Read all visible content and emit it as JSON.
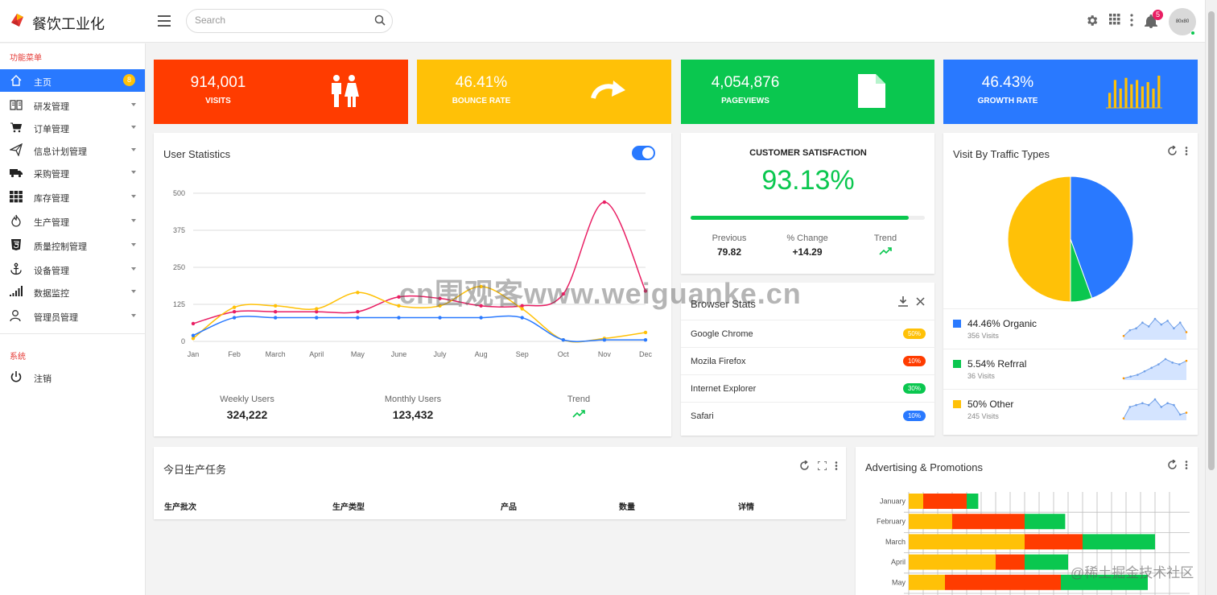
{
  "app": {
    "title": "餐饮工业化"
  },
  "header": {
    "search_placeholder": "Search",
    "notification_count": "5",
    "avatar_text": "80x80"
  },
  "sidebar": {
    "section_main": "功能菜单",
    "items": [
      {
        "label": "主页",
        "icon": "home-icon",
        "badge": "8",
        "active": true
      },
      {
        "label": "研发管理",
        "icon": "book-icon"
      },
      {
        "label": "订单管理",
        "icon": "cart-icon"
      },
      {
        "label": "信息计划管理",
        "icon": "send-icon"
      },
      {
        "label": "采购管理",
        "icon": "truck-icon"
      },
      {
        "label": "库存管理",
        "icon": "grid-icon"
      },
      {
        "label": "生产管理",
        "icon": "fire-icon"
      },
      {
        "label": "质量控制管理",
        "icon": "html5-icon"
      },
      {
        "label": "设备管理",
        "icon": "anchor-icon"
      },
      {
        "label": "数据监控",
        "icon": "signal-icon"
      },
      {
        "label": "管理员管理",
        "icon": "user-icon"
      }
    ],
    "section_system": "系统",
    "logout_label": "注销"
  },
  "stats": [
    {
      "value": "914,001",
      "label": "VISITS",
      "color": "#ff3c00",
      "icon": "people-icon"
    },
    {
      "value": "46.41%",
      "label": "BOUNCE RATE",
      "color": "#ffc107",
      "icon": "redo-arrow-icon"
    },
    {
      "value": "4,054,876",
      "label": "PAGEVIEWS",
      "color": "#0ac74f",
      "icon": "document-icon"
    },
    {
      "value": "46.43%",
      "label": "GROWTH RATE",
      "color": "#2979ff",
      "icon": "bar-spark-icon",
      "spark": [
        7,
        13,
        9,
        14,
        11,
        13,
        10,
        12,
        9,
        15
      ]
    }
  ],
  "user_stats": {
    "title": "User Statistics",
    "toggle_on": true,
    "weekly_label": "Weekly Users",
    "weekly_value": "324,222",
    "monthly_label": "Monthly Users",
    "monthly_value": "123,432",
    "trend_label": "Trend"
  },
  "chart_data": [
    {
      "type": "line",
      "title": "User Statistics",
      "x": [
        "Jan",
        "Feb",
        "March",
        "April",
        "May",
        "June",
        "July",
        "Aug",
        "Sep",
        "Oct",
        "Nov",
        "Dec"
      ],
      "ylim": [
        0,
        500
      ],
      "yticks": [
        0,
        125,
        250,
        375,
        500
      ],
      "grid": true,
      "series": [
        {
          "color": "#e91e63",
          "values": [
            60,
            100,
            100,
            100,
            100,
            150,
            145,
            120,
            120,
            160,
            470,
            170
          ]
        },
        {
          "color": "#ffc107",
          "values": [
            10,
            115,
            120,
            110,
            165,
            120,
            120,
            185,
            110,
            5,
            10,
            30
          ]
        },
        {
          "color": "#2979ff",
          "values": [
            20,
            80,
            80,
            80,
            80,
            80,
            80,
            80,
            80,
            5,
            5,
            5
          ]
        }
      ]
    },
    {
      "type": "pie",
      "title": "Visit By Traffic Types",
      "slices": [
        {
          "label": "44.46% Organic",
          "value": 44.46,
          "color": "#2979ff"
        },
        {
          "label": "5.54% Refrral",
          "value": 5.54,
          "color": "#0ac74f"
        },
        {
          "label": "50% Other",
          "value": 50,
          "color": "#ffc107"
        }
      ]
    },
    {
      "type": "bar",
      "title": "Advertising & Promotions",
      "orientation": "horizontal-stacked",
      "categories": [
        "January",
        "February",
        "March",
        "April",
        "May"
      ],
      "grid": true,
      "series": [
        {
          "color": "#ffc107",
          "values": [
            1,
            3,
            8,
            6,
            2.5
          ]
        },
        {
          "color": "#ff3c00",
          "values": [
            3,
            5,
            4,
            2,
            8
          ]
        },
        {
          "color": "#0ac74f",
          "values": [
            0.8,
            2.8,
            5,
            3,
            6
          ]
        }
      ]
    }
  ],
  "satisfaction": {
    "title": "CUSTOMER SATISFACTION",
    "value": "93.13%",
    "progress": 0.9313,
    "previous_label": "Previous",
    "previous_value": "79.82",
    "change_label": "% Change",
    "change_value": "+14.29",
    "trend_label": "Trend"
  },
  "browser_stats": {
    "title": "Browser Stats",
    "rows": [
      {
        "name": "Google Chrome",
        "pct": "50%",
        "color": "#ffc107"
      },
      {
        "name": "Mozila Firefox",
        "pct": "10%",
        "color": "#ff3c00"
      },
      {
        "name": "Internet Explorer",
        "pct": "30%",
        "color": "#0ac74f"
      },
      {
        "name": "Safari",
        "pct": "10%",
        "color": "#2979ff"
      }
    ]
  },
  "traffic": {
    "title": "Visit By Traffic Types",
    "rows": [
      {
        "title": "44.46% Organic",
        "sub": "356 Visits",
        "color": "#2979ff",
        "spark": [
          2,
          5,
          6,
          9,
          7,
          11,
          8,
          10,
          6,
          9,
          4
        ]
      },
      {
        "title": "5.54% Refrral",
        "sub": "36 Visits",
        "color": "#0ac74f",
        "spark": [
          1,
          2,
          3,
          5,
          7,
          9,
          12,
          10,
          9,
          11
        ]
      },
      {
        "title": "50% Other",
        "sub": "245 Visits",
        "color": "#ffc107",
        "spark": [
          1,
          7,
          8,
          9,
          8,
          11,
          7,
          9,
          8,
          3,
          4
        ]
      }
    ]
  },
  "tasks": {
    "title": "今日生产任务",
    "columns": [
      "生产批次",
      "生产类型",
      "产品",
      "数量",
      "详情"
    ]
  },
  "ads": {
    "title": "Advertising & Promotions"
  },
  "watermark": "cn围观客www.weiguanke.cn",
  "juejin": "@稀土掘金技术社区"
}
